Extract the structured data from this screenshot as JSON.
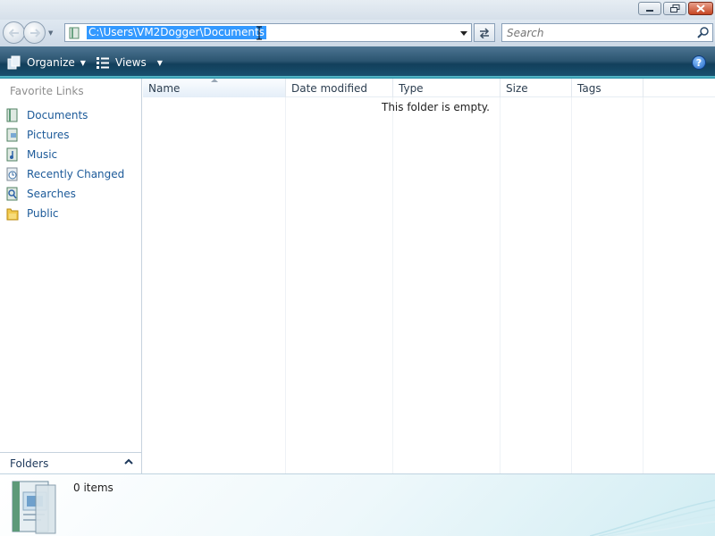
{
  "address": {
    "path": "C:\\Users\\VM2Dogger\\Documents"
  },
  "search": {
    "placeholder": "Search"
  },
  "toolbar": {
    "organize_label": "Organize",
    "views_label": "Views",
    "help_label": "?"
  },
  "nav": {
    "title": "Favorite Links",
    "items": [
      {
        "label": "Documents",
        "icon": "documents-icon"
      },
      {
        "label": "Pictures",
        "icon": "pictures-icon"
      },
      {
        "label": "Music",
        "icon": "music-icon"
      },
      {
        "label": "Recently Changed",
        "icon": "recently-changed-icon"
      },
      {
        "label": "Searches",
        "icon": "searches-icon"
      },
      {
        "label": "Public",
        "icon": "public-folder-icon"
      }
    ],
    "folders_label": "Folders"
  },
  "columns": [
    "Name",
    "Date modified",
    "Type",
    "Size",
    "Tags"
  ],
  "main": {
    "empty_text": "This folder is empty."
  },
  "details": {
    "item_count": "0 items"
  },
  "colors": {
    "toolbar_dark": "#123f5b",
    "link": "#1c5a99",
    "selection": "#3399ff",
    "close_red": "#c64522"
  }
}
